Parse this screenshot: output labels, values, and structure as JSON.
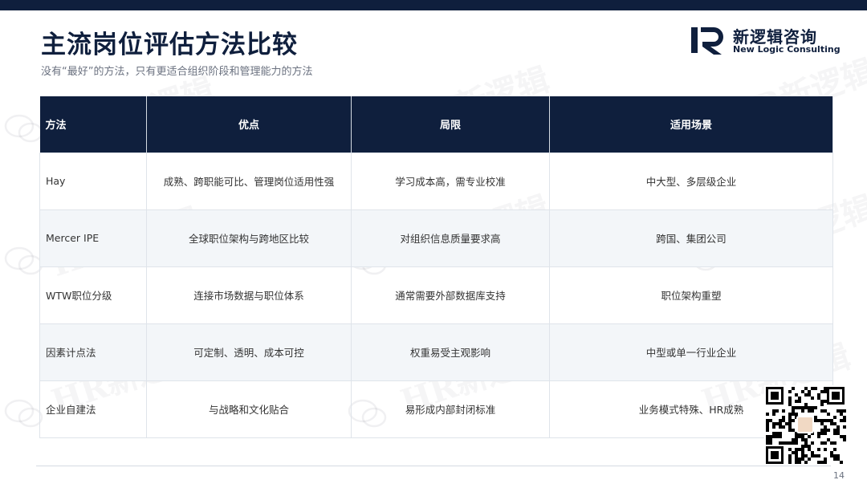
{
  "header": {
    "title": "主流岗位评估方法比较",
    "subtitle": "没有“最好”的方法，只有更适合组织阶段和管理能力的方法"
  },
  "logo": {
    "name_cn": "新逻辑咨询",
    "name_en": "New Logic Consulting",
    "mark_icon": "hr-logo-mark"
  },
  "watermark": {
    "text": "HR新逻辑",
    "icon": "wechat-icon"
  },
  "table": {
    "headers": [
      "方法",
      "优点",
      "局限",
      "适用场景"
    ],
    "rows": [
      [
        "Hay",
        "成熟、跨职能可比、管理岗位适用性强",
        "学习成本高，需专业校准",
        "中大型、多层级企业"
      ],
      [
        "Mercer IPE",
        "全球职位架构与跨地区比较",
        "对组织信息质量要求高",
        "跨国、集团公司"
      ],
      [
        "WTW职位分级",
        "连接市场数据与职位体系",
        "通常需要外部数据库支持",
        "职位架构重塑"
      ],
      [
        "因素计点法",
        "可定制、透明、成本可控",
        "权重易受主观影响",
        "中型或单一行业企业"
      ],
      [
        "企业自建法",
        "与战略和文化贴合",
        "易形成内部封闭标准",
        "业务模式特殊、HR成熟"
      ]
    ]
  },
  "footer": {
    "page_number": "14",
    "qr_icon": "qr-code-icon"
  },
  "colors": {
    "navy": "#0f1f3d",
    "alt_row": "#f3f6f9",
    "border": "#dfe4ea"
  }
}
